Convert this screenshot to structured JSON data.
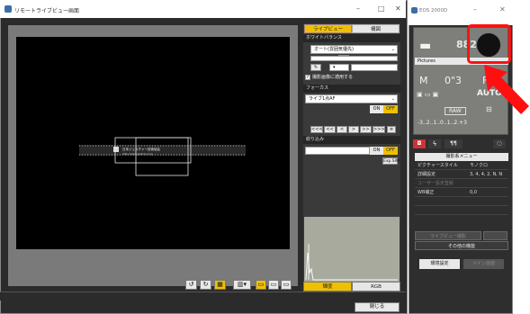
{
  "lv_window": {
    "title": "リモートライブビュー画面",
    "minimize": "–",
    "maximize": "□",
    "close": "✕",
    "tabs": {
      "liveview": "ライブビュー",
      "enlarge": "構図"
    },
    "white_balance": {
      "section": "ホワイトバランス",
      "mode": "オート(雰囲気優先)",
      "dropper_icon": "eyedropper-icon",
      "apply_label": "撮影画像に適用する"
    },
    "focus": {
      "section": "フォーカス",
      "mode": "ライブ1点AF",
      "on": "ON",
      "off": "OFF",
      "nav": [
        "<<<",
        "<<",
        "<",
        ">",
        ">>",
        ">>>"
      ]
    },
    "narrowing": {
      "section": "絞り込み",
      "on": "ON",
      "off": "OFF",
      "exp_sim": "Exp.SIM"
    },
    "histogram_tabs": {
      "brightness": "輝度",
      "rgb": "RGB"
    },
    "close_button": "閉じる",
    "image_label": {
      "ja": "日本ジェスチャー技術協会",
      "en": "http://www.gesture.or.jp"
    }
  },
  "eos": {
    "title": "EOS 2000D",
    "battery_value": "882",
    "folder": "Pictures",
    "mode": "M",
    "shutter": "0\"3",
    "aperture": "F10",
    "af_mode": "AUTO",
    "raw": "RAW",
    "exposure_scale": "-3..2..1..0..1..2.+3",
    "tabs": [
      "camera-icon",
      "lightning-icon",
      "settings-icon"
    ],
    "menu_head": "撮影系メニュー",
    "menu": [
      {
        "label": "ピクチャースタイル",
        "value": "モノクロ"
      },
      {
        "label": "詳細設定",
        "value": "3, 4, 4, 2, N, N"
      },
      {
        "label": "ユーザー設定登録",
        "value": ""
      },
      {
        "label": "WB補正",
        "value": "0,0"
      }
    ],
    "liveview_shoot": "ライブビュー撮影",
    "other": "その他の機能",
    "preferences": "環境設定",
    "main_window": "メイン画面"
  },
  "colors": {
    "accent": "#f0c000",
    "highlight": "#ff1010",
    "arrow": "#ff1010"
  }
}
